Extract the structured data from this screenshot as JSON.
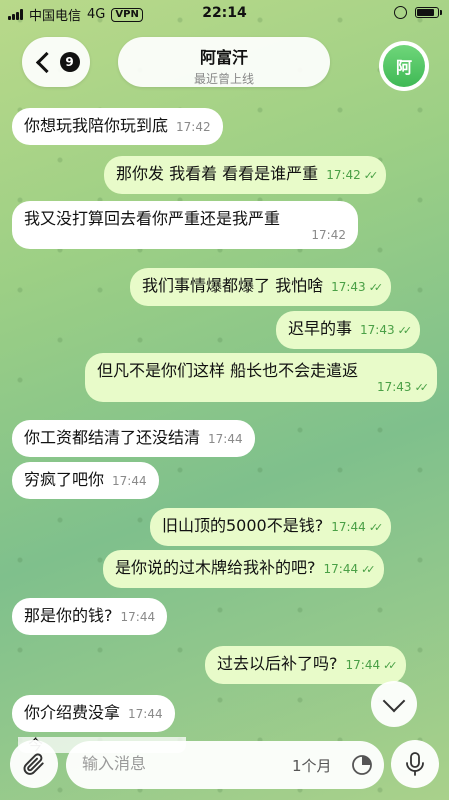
{
  "status_bar": {
    "carrier": "中国电信",
    "network": "4G",
    "vpn": "VPN",
    "time": "22:14"
  },
  "header": {
    "unread_count": "9",
    "title": "阿富汗",
    "subtitle": "最近曾上线",
    "avatar_letter": "阿"
  },
  "messages": [
    {
      "dir": "in",
      "text": "你想玩我陪你玩到底",
      "time": "17:42"
    },
    {
      "dir": "out",
      "text": "那你发 我看着 看看是谁严重",
      "time": "17:42"
    },
    {
      "dir": "in",
      "text": "我又没打算回去看你严重还是我严重",
      "time": "17:42"
    },
    {
      "dir": "out",
      "text": "我们事情爆都爆了 我怕啥",
      "time": "17:43"
    },
    {
      "dir": "out",
      "text": "迟早的事",
      "time": "17:43"
    },
    {
      "dir": "out",
      "text": "但凡不是你们这样 船长也不会走遣返",
      "time": "17:43"
    },
    {
      "dir": "in",
      "text": "你工资都结清了还没结清",
      "time": "17:44"
    },
    {
      "dir": "in",
      "text": "穷疯了吧你",
      "time": "17:44"
    },
    {
      "dir": "out",
      "text": "旧山顶的5000不是钱?",
      "time": "17:44"
    },
    {
      "dir": "out",
      "text": "是你说的过木牌给我补的吧?",
      "time": "17:44"
    },
    {
      "dir": "in",
      "text": "那是你的钱?",
      "time": "17:44"
    },
    {
      "dir": "out",
      "text": "过去以后补了吗?",
      "time": "17:44"
    },
    {
      "dir": "in",
      "text": "你介绍费没拿",
      "time": "17:44"
    }
  ],
  "peek_message": "今",
  "input": {
    "placeholder": "输入消息",
    "timer": "1个月"
  },
  "colors": {
    "incoming_bubble": "#ffffff",
    "outgoing_bubble": "#e8fbc9",
    "read_tick": "#4aa046"
  }
}
